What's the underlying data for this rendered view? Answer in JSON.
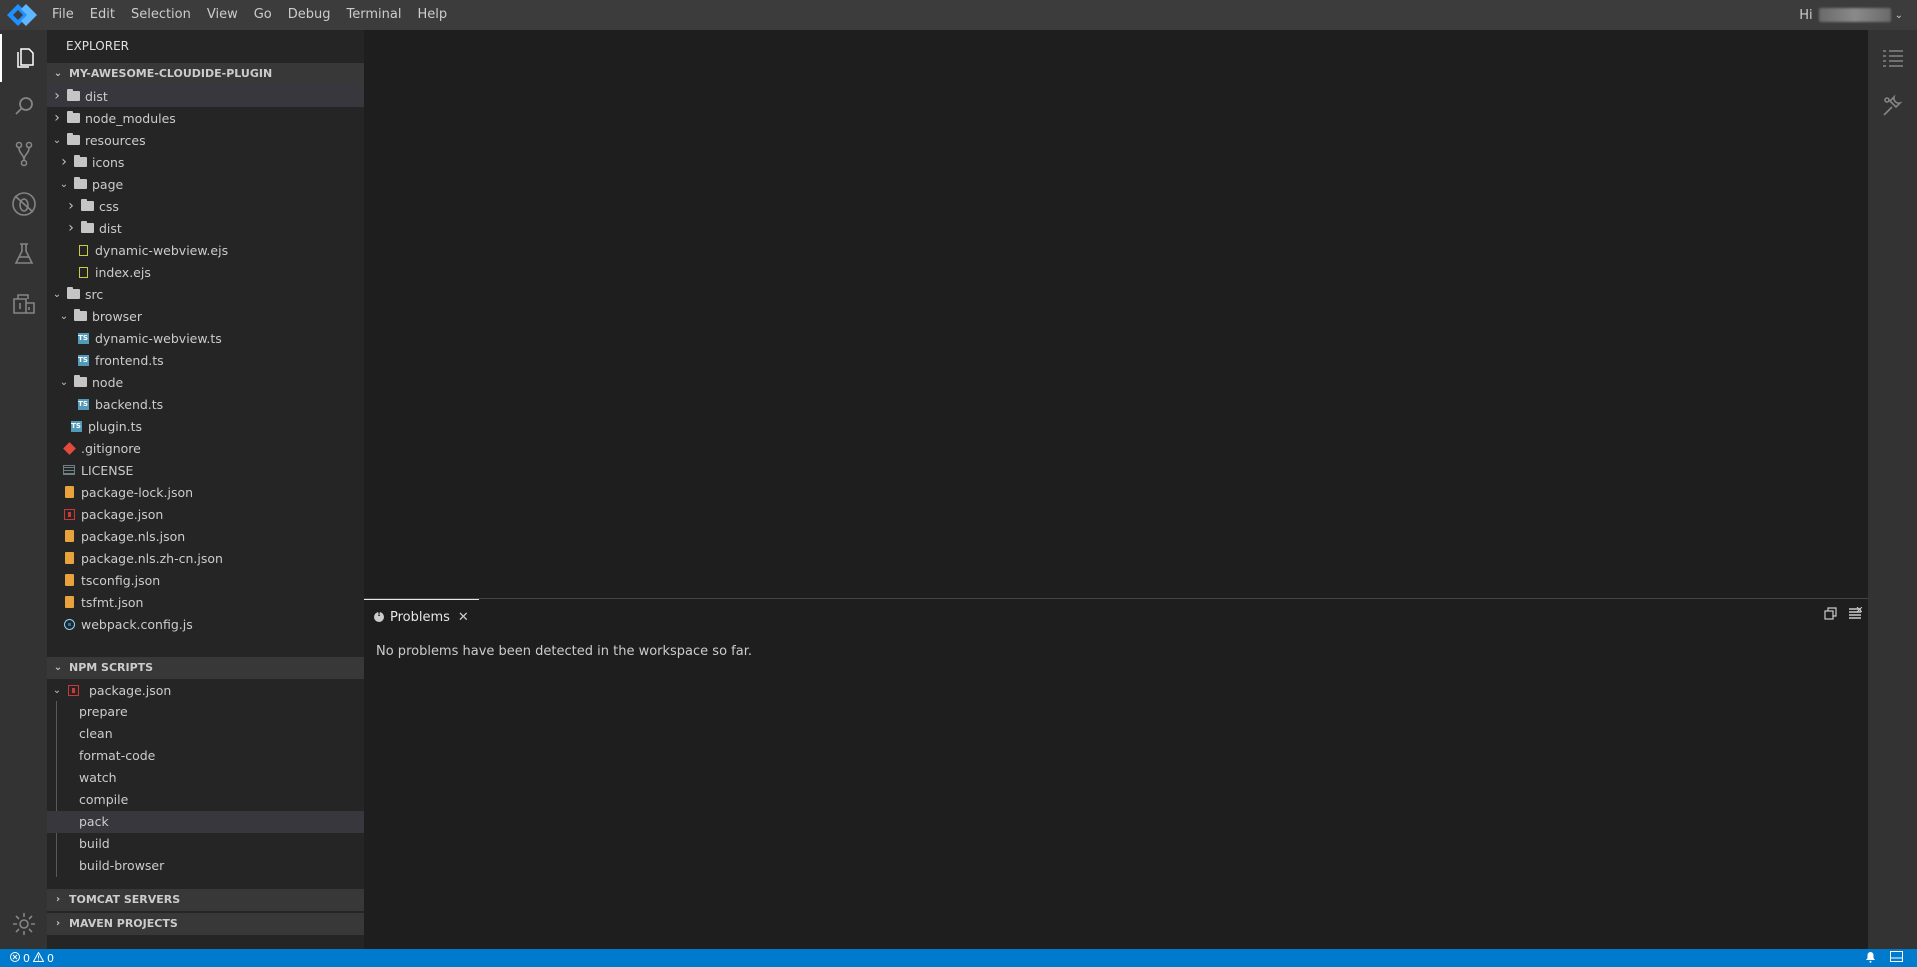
{
  "menubar": {
    "items": [
      "File",
      "Edit",
      "Selection",
      "View",
      "Go",
      "Debug",
      "Terminal",
      "Help"
    ],
    "greeting": "Hi"
  },
  "activitybar": {
    "icons": [
      "explorer-icon",
      "search-icon",
      "source-control-icon",
      "debug-icon",
      "test-flask-icon",
      "extensions-icon",
      "settings-gear-icon"
    ]
  },
  "sidebar": {
    "title": "EXPLORER",
    "project": {
      "name": "MY-AWESOME-CLOUDIDE-PLUGIN",
      "tree": [
        {
          "label": "dist",
          "type": "folder",
          "depth": 0,
          "expanded": false,
          "selected": true
        },
        {
          "label": "node_modules",
          "type": "folder",
          "depth": 0,
          "expanded": false
        },
        {
          "label": "resources",
          "type": "folder",
          "depth": 0,
          "expanded": true
        },
        {
          "label": "icons",
          "type": "folder",
          "depth": 1,
          "expanded": false
        },
        {
          "label": "page",
          "type": "folder",
          "depth": 1,
          "expanded": true
        },
        {
          "label": "css",
          "type": "folder",
          "depth": 2,
          "expanded": false
        },
        {
          "label": "dist",
          "type": "folder",
          "depth": 2,
          "expanded": false
        },
        {
          "label": "dynamic-webview.ejs",
          "type": "ejs",
          "depth": 2
        },
        {
          "label": "index.ejs",
          "type": "ejs",
          "depth": 2
        },
        {
          "label": "src",
          "type": "folder",
          "depth": 0,
          "expanded": true
        },
        {
          "label": "browser",
          "type": "folder",
          "depth": 1,
          "expanded": true
        },
        {
          "label": "dynamic-webview.ts",
          "type": "ts",
          "depth": 2
        },
        {
          "label": "frontend.ts",
          "type": "ts",
          "depth": 2
        },
        {
          "label": "node",
          "type": "folder",
          "depth": 1,
          "expanded": true
        },
        {
          "label": "backend.ts",
          "type": "ts",
          "depth": 2
        },
        {
          "label": "plugin.ts",
          "type": "ts",
          "depth": 1
        },
        {
          "label": ".gitignore",
          "type": "git",
          "depth": 0
        },
        {
          "label": "LICENSE",
          "type": "license",
          "depth": 0
        },
        {
          "label": "package-lock.json",
          "type": "json-orange",
          "depth": 0
        },
        {
          "label": "package.json",
          "type": "npm",
          "depth": 0
        },
        {
          "label": "package.nls.json",
          "type": "json-orange",
          "depth": 0
        },
        {
          "label": "package.nls.zh-cn.json",
          "type": "json-orange",
          "depth": 0
        },
        {
          "label": "tsconfig.json",
          "type": "json-orange",
          "depth": 0
        },
        {
          "label": "tsfmt.json",
          "type": "json-orange",
          "depth": 0
        },
        {
          "label": "webpack.config.js",
          "type": "webpack",
          "depth": 0
        }
      ]
    },
    "npm_scripts": {
      "title": "NPM SCRIPTS",
      "package": "package.json",
      "scripts": [
        "prepare",
        "clean",
        "format-code",
        "watch",
        "compile",
        "pack",
        "build",
        "build-browser"
      ],
      "selected": "pack"
    },
    "tomcat": {
      "title": "TOMCAT SERVERS"
    },
    "maven": {
      "title": "MAVEN PROJECTS"
    }
  },
  "panel": {
    "tab_label": "Problems",
    "message": "No problems have been detected in the workspace so far."
  },
  "statusbar": {
    "errors": "0",
    "warnings": "0"
  },
  "colors": {
    "accent": "#007acc",
    "menubar": "#3c3c3c",
    "activitybar": "#333333",
    "sidebar": "#252526",
    "editor": "#1e1e1e"
  }
}
